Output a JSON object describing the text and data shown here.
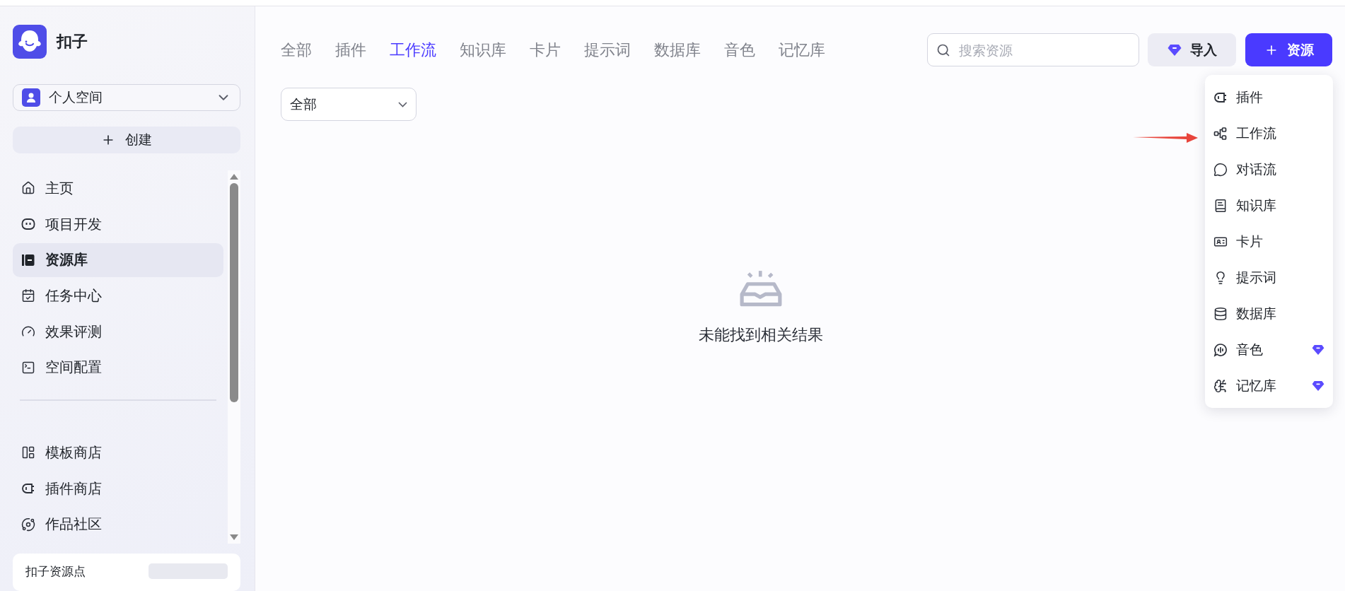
{
  "app": {
    "name": "扣子"
  },
  "sidebar": {
    "space_selector": {
      "label": "个人空间"
    },
    "create_button": {
      "label": "创建"
    },
    "nav_items": [
      {
        "label": "主页",
        "selected": false
      },
      {
        "label": "项目开发",
        "selected": false
      },
      {
        "label": "资源库",
        "selected": true
      },
      {
        "label": "任务中心",
        "selected": false
      },
      {
        "label": "效果评测",
        "selected": false
      },
      {
        "label": "空间配置",
        "selected": false
      }
    ],
    "store_items": [
      {
        "label": "模板商店",
        "selected": false
      },
      {
        "label": "插件商店",
        "selected": false
      },
      {
        "label": "作品社区",
        "selected": false
      }
    ],
    "footer_card": {
      "title": "扣子资源点"
    }
  },
  "tabs": [
    {
      "label": "全部",
      "selected": false
    },
    {
      "label": "插件",
      "selected": false
    },
    {
      "label": "工作流",
      "selected": true
    },
    {
      "label": "知识库",
      "selected": false
    },
    {
      "label": "卡片",
      "selected": false
    },
    {
      "label": "提示词",
      "selected": false
    },
    {
      "label": "数据库",
      "selected": false
    },
    {
      "label": "音色",
      "selected": false
    },
    {
      "label": "记忆库",
      "selected": false
    }
  ],
  "filter_select": {
    "value": "全部"
  },
  "search": {
    "placeholder": "搜索资源"
  },
  "import_button": {
    "label": "导入"
  },
  "add_resource_button": {
    "label": "资源"
  },
  "resource_menu": [
    {
      "label": "插件",
      "premium": false
    },
    {
      "label": "工作流",
      "premium": false
    },
    {
      "label": "对话流",
      "premium": false
    },
    {
      "label": "知识库",
      "premium": false
    },
    {
      "label": "卡片",
      "premium": false
    },
    {
      "label": "提示词",
      "premium": false
    },
    {
      "label": "数据库",
      "premium": false
    },
    {
      "label": "音色",
      "premium": true
    },
    {
      "label": "记忆库",
      "premium": true
    }
  ],
  "empty_state": {
    "message": "未能找到相关结果"
  }
}
